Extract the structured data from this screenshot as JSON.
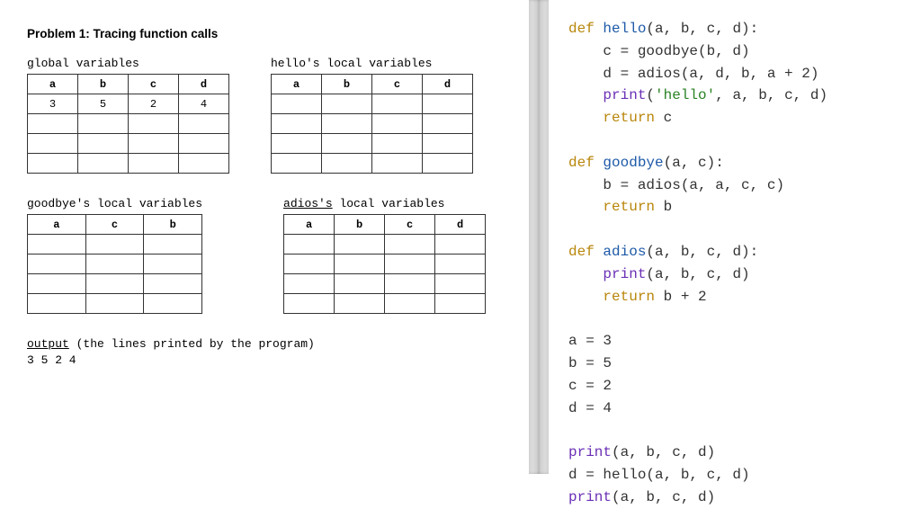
{
  "problem_title": "Problem 1: Tracing function calls",
  "tables": {
    "global": {
      "label": "global variables",
      "headers": [
        "a",
        "b",
        "c",
        "d"
      ],
      "rows": [
        [
          "3",
          "5",
          "2",
          "4"
        ],
        [
          "",
          "",
          "",
          ""
        ],
        [
          "",
          "",
          "",
          ""
        ],
        [
          "",
          "",
          "",
          ""
        ]
      ]
    },
    "hello": {
      "label": "hello's local variables",
      "headers": [
        "a",
        "b",
        "c",
        "d"
      ],
      "rows": [
        [
          "",
          "",
          "",
          ""
        ],
        [
          "",
          "",
          "",
          ""
        ],
        [
          "",
          "",
          "",
          ""
        ],
        [
          "",
          "",
          "",
          ""
        ]
      ]
    },
    "goodbye": {
      "label": "goodbye's local variables",
      "headers": [
        "a",
        "c",
        "b"
      ],
      "rows": [
        [
          "",
          "",
          ""
        ],
        [
          "",
          "",
          ""
        ],
        [
          "",
          "",
          ""
        ],
        [
          "",
          "",
          ""
        ]
      ]
    },
    "adios": {
      "label_prefix": "adios's",
      "label_suffix": " local variables",
      "headers": [
        "a",
        "b",
        "c",
        "d"
      ],
      "rows": [
        [
          "",
          "",
          "",
          ""
        ],
        [
          "",
          "",
          "",
          ""
        ],
        [
          "",
          "",
          "",
          ""
        ],
        [
          "",
          "",
          "",
          ""
        ]
      ]
    }
  },
  "output_label_underlined": "output",
  "output_label_rest": " (the lines printed by the program)",
  "output_lines": "3 5 2 4",
  "code": {
    "l1_def": "def ",
    "l1_fn": "hello",
    "l1_rest": "(a, b, c, d):",
    "l2": "    c = goodbye(b, d)",
    "l3": "    d = adios(a, d, b, a + 2)",
    "l4_ind": "    ",
    "l4_print": "print",
    "l4_paren": "(",
    "l4_str": "'hello'",
    "l4_rest": ", a, b, c, d)",
    "l5_ind": "    ",
    "l5_ret": "return ",
    "l5_val": "c",
    "l6_def": "def ",
    "l6_fn": "goodbye",
    "l6_rest": "(a, c):",
    "l7": "    b = adios(a, a, c, c)",
    "l8_ind": "    ",
    "l8_ret": "return ",
    "l8_val": "b",
    "l9_def": "def ",
    "l9_fn": "adios",
    "l9_rest": "(a, b, c, d):",
    "l10_ind": "    ",
    "l10_print": "print",
    "l10_rest": "(a, b, c, d)",
    "l11_ind": "    ",
    "l11_ret": "return ",
    "l11_val": "b + 2",
    "l12": "a = 3",
    "l13": "b = 5",
    "l14": "c = 2",
    "l15": "d = 4",
    "l16_print": "print",
    "l16_rest": "(a, b, c, d)",
    "l17": "d = hello(a, b, c, d)",
    "l18_print": "print",
    "l18_rest": "(a, b, c, d)"
  }
}
